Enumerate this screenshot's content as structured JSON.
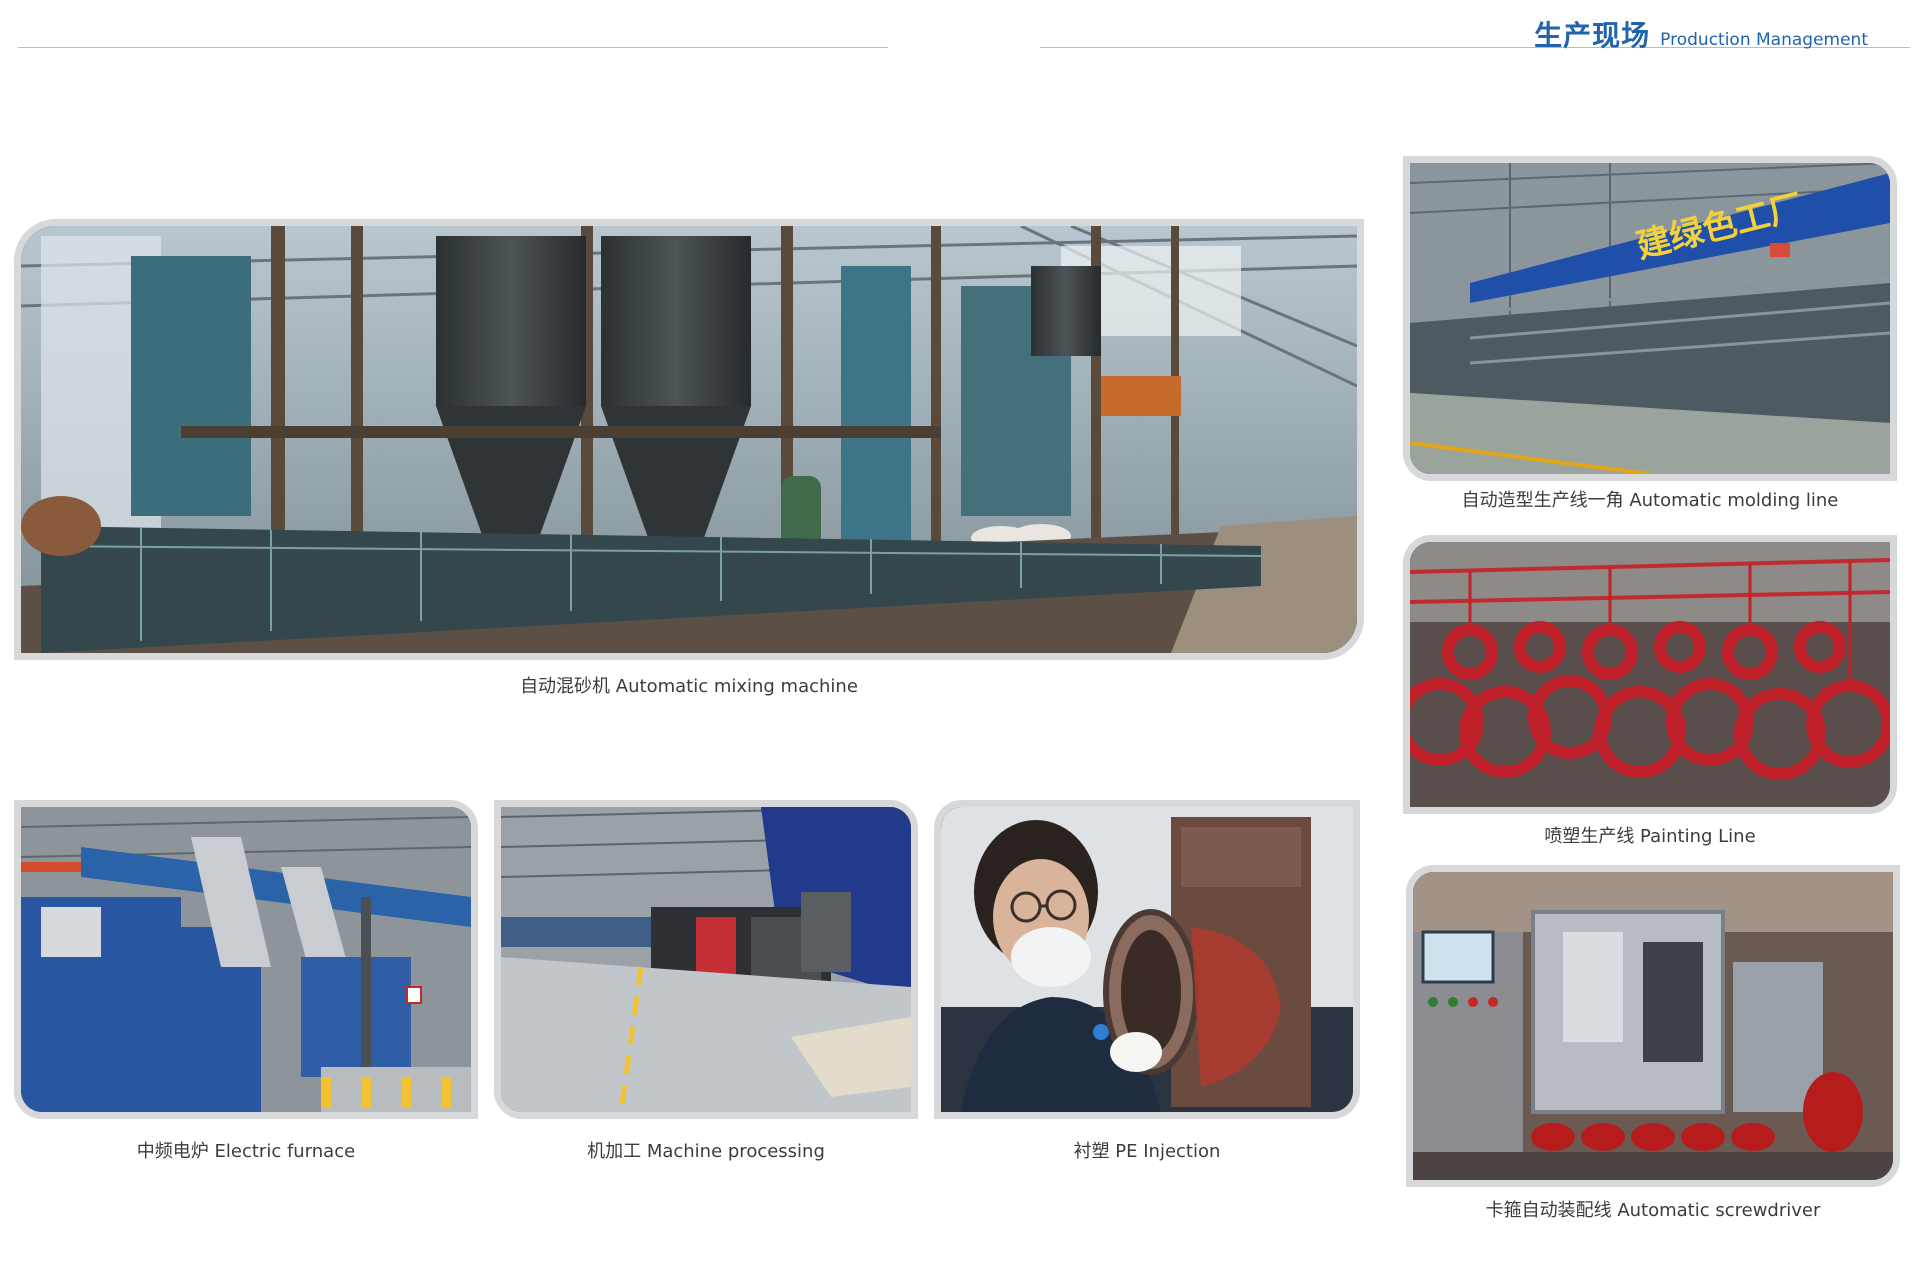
{
  "header": {
    "title_cn": "生产现场",
    "title_en": "Production Management"
  },
  "photos": {
    "mixing": {
      "caption": "自动混砂机  Automatic mixing machine",
      "subject": "automatic-mixing-machine"
    },
    "molding": {
      "caption": "自动造型生产线一角  Automatic molding line",
      "subject": "automatic-molding-line",
      "banner_text": "建绿色工厂"
    },
    "painting": {
      "caption": "喷塑生产线  Painting Line",
      "subject": "painting-line"
    },
    "screwdriver": {
      "caption": "卡箍自动装配线  Automatic screwdriver",
      "subject": "automatic-screwdriver"
    },
    "furnace": {
      "caption": "中频电炉 Electric furnace",
      "subject": "electric-furnace"
    },
    "machining": {
      "caption": "机加工  Machine processing",
      "subject": "machine-processing"
    },
    "injection": {
      "caption": "衬塑 PE Injection",
      "subject": "pe-injection"
    }
  },
  "colors": {
    "brand_blue": "#1f64ad",
    "frame_gray": "#d6d8da",
    "rule_gray": "#b8bcc2",
    "coupling_red": "#c0202a"
  }
}
